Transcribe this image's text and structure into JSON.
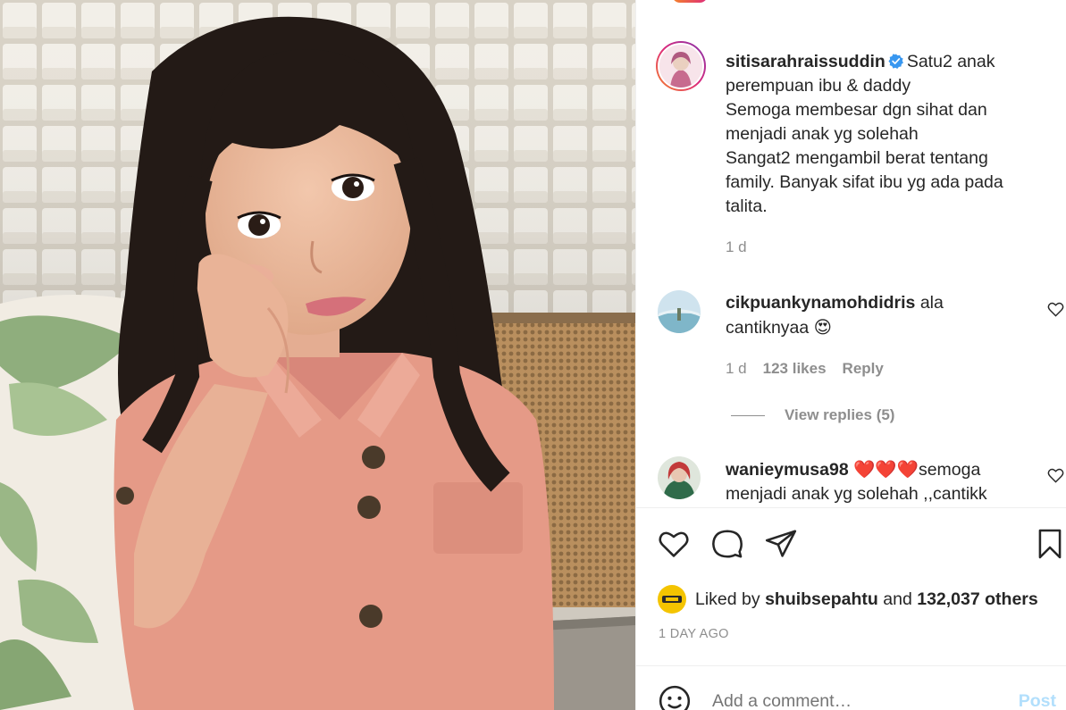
{
  "post": {
    "author": {
      "username": "sitisarahraissuddin",
      "verified": true
    },
    "caption_lines": [
      "Satu2 anak",
      "perempuan ibu & daddy",
      "Semoga membesar dgn sihat dan",
      "menjadi anak yg solehah",
      "Sangat2 mengambil berat tentang",
      "family. Banyak sifat ibu yg ada pada",
      "talita."
    ],
    "caption_time": "1 d"
  },
  "comments": [
    {
      "username": "cikpuankynamohdidris",
      "text_line1": "ala",
      "text_line2": "cantiknyaa",
      "emoji": "😍",
      "time": "1 d",
      "likes": "123 likes",
      "reply_label": "Reply",
      "view_replies": "View replies (5)"
    },
    {
      "username": "wanieymusa98",
      "hearts": "❤️❤️❤️",
      "text_line1": "semoga",
      "text_line2": "menjadi anak yg solehah ,,cantikk"
    }
  ],
  "actions": {
    "icons": [
      "heart-icon",
      "comment-icon",
      "share-icon",
      "bookmark-icon"
    ]
  },
  "likes": {
    "prefix": "Liked by",
    "user": "shuibsepahtu",
    "middle": "and",
    "count": "132,037 others"
  },
  "posted_ago": "1 DAY AGO",
  "comment_box": {
    "placeholder": "Add a comment…",
    "post_label": "Post"
  },
  "colors": {
    "text": "#262626",
    "muted": "#8e8e8e",
    "link_disabled": "#b2dffc",
    "verified": "#3897f0",
    "heart_red": "#ed4956"
  }
}
